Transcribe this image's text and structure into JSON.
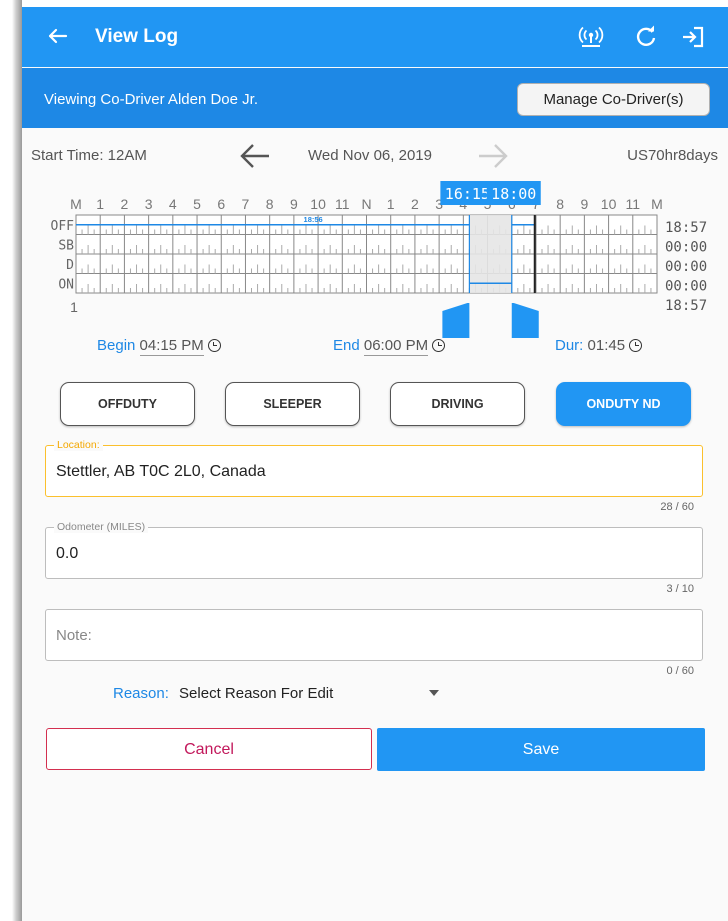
{
  "colors": {
    "primary": "#2196f3",
    "primary_dark": "#1e88e5",
    "cancel": "#c2185b",
    "focus": "#fbc02d"
  },
  "toolbar": {
    "title": "View Log",
    "icons": [
      "back-arrow-icon",
      "wireless-signal-icon",
      "refresh-icon",
      "logout-icon"
    ]
  },
  "subbar": {
    "viewing_text": "Viewing Co-Driver Alden Doe Jr.",
    "manage_button": "Manage Co-Driver(s)"
  },
  "nav": {
    "start_time": "Start Time: 12AM",
    "date": "Wed Nov 06, 2019",
    "cycle": "US70hr8days"
  },
  "graph": {
    "hour_labels": [
      "M",
      "1",
      "2",
      "3",
      "4",
      "5",
      "6",
      "7",
      "8",
      "9",
      "10",
      "11",
      "N",
      "1",
      "2",
      "3",
      "4",
      "5",
      "6",
      "7",
      "8",
      "9",
      "10",
      "11",
      "M"
    ],
    "status_labels": [
      "OFF",
      "SB",
      "D",
      "ON"
    ],
    "totals": [
      "18:57",
      "00:00",
      "00:00",
      "00:00",
      "18:57"
    ],
    "day_number": "1",
    "marker_label": "18:56",
    "selection_start_chip": "16:15",
    "selection_end_chip": "18:00",
    "selection_start_hour": 16.25,
    "selection_end_hour": 18.0,
    "offduty_end_hour": 18.95
  },
  "times": {
    "begin_label": "Begin",
    "begin_value": "04:15 PM",
    "end_label": "End",
    "end_value": "06:00 PM",
    "dur_label": "Dur:",
    "dur_value": "01:45"
  },
  "duty_buttons": {
    "off": "OFFDUTY",
    "sleeper": "SLEEPER",
    "driving": "DRIVING",
    "onduty": "ONDUTY ND"
  },
  "location": {
    "label": "Location:",
    "value": "Stettler, AB T0C 2L0, Canada",
    "counter": "28 / 60"
  },
  "odometer": {
    "label": "Odometer (MILES)",
    "value": "0.0",
    "counter": "3 / 10"
  },
  "note": {
    "placeholder": "Note:",
    "counter": "0 / 60"
  },
  "reason": {
    "label": "Reason:",
    "value": "Select Reason For Edit"
  },
  "actions": {
    "cancel": "Cancel",
    "save": "Save"
  }
}
